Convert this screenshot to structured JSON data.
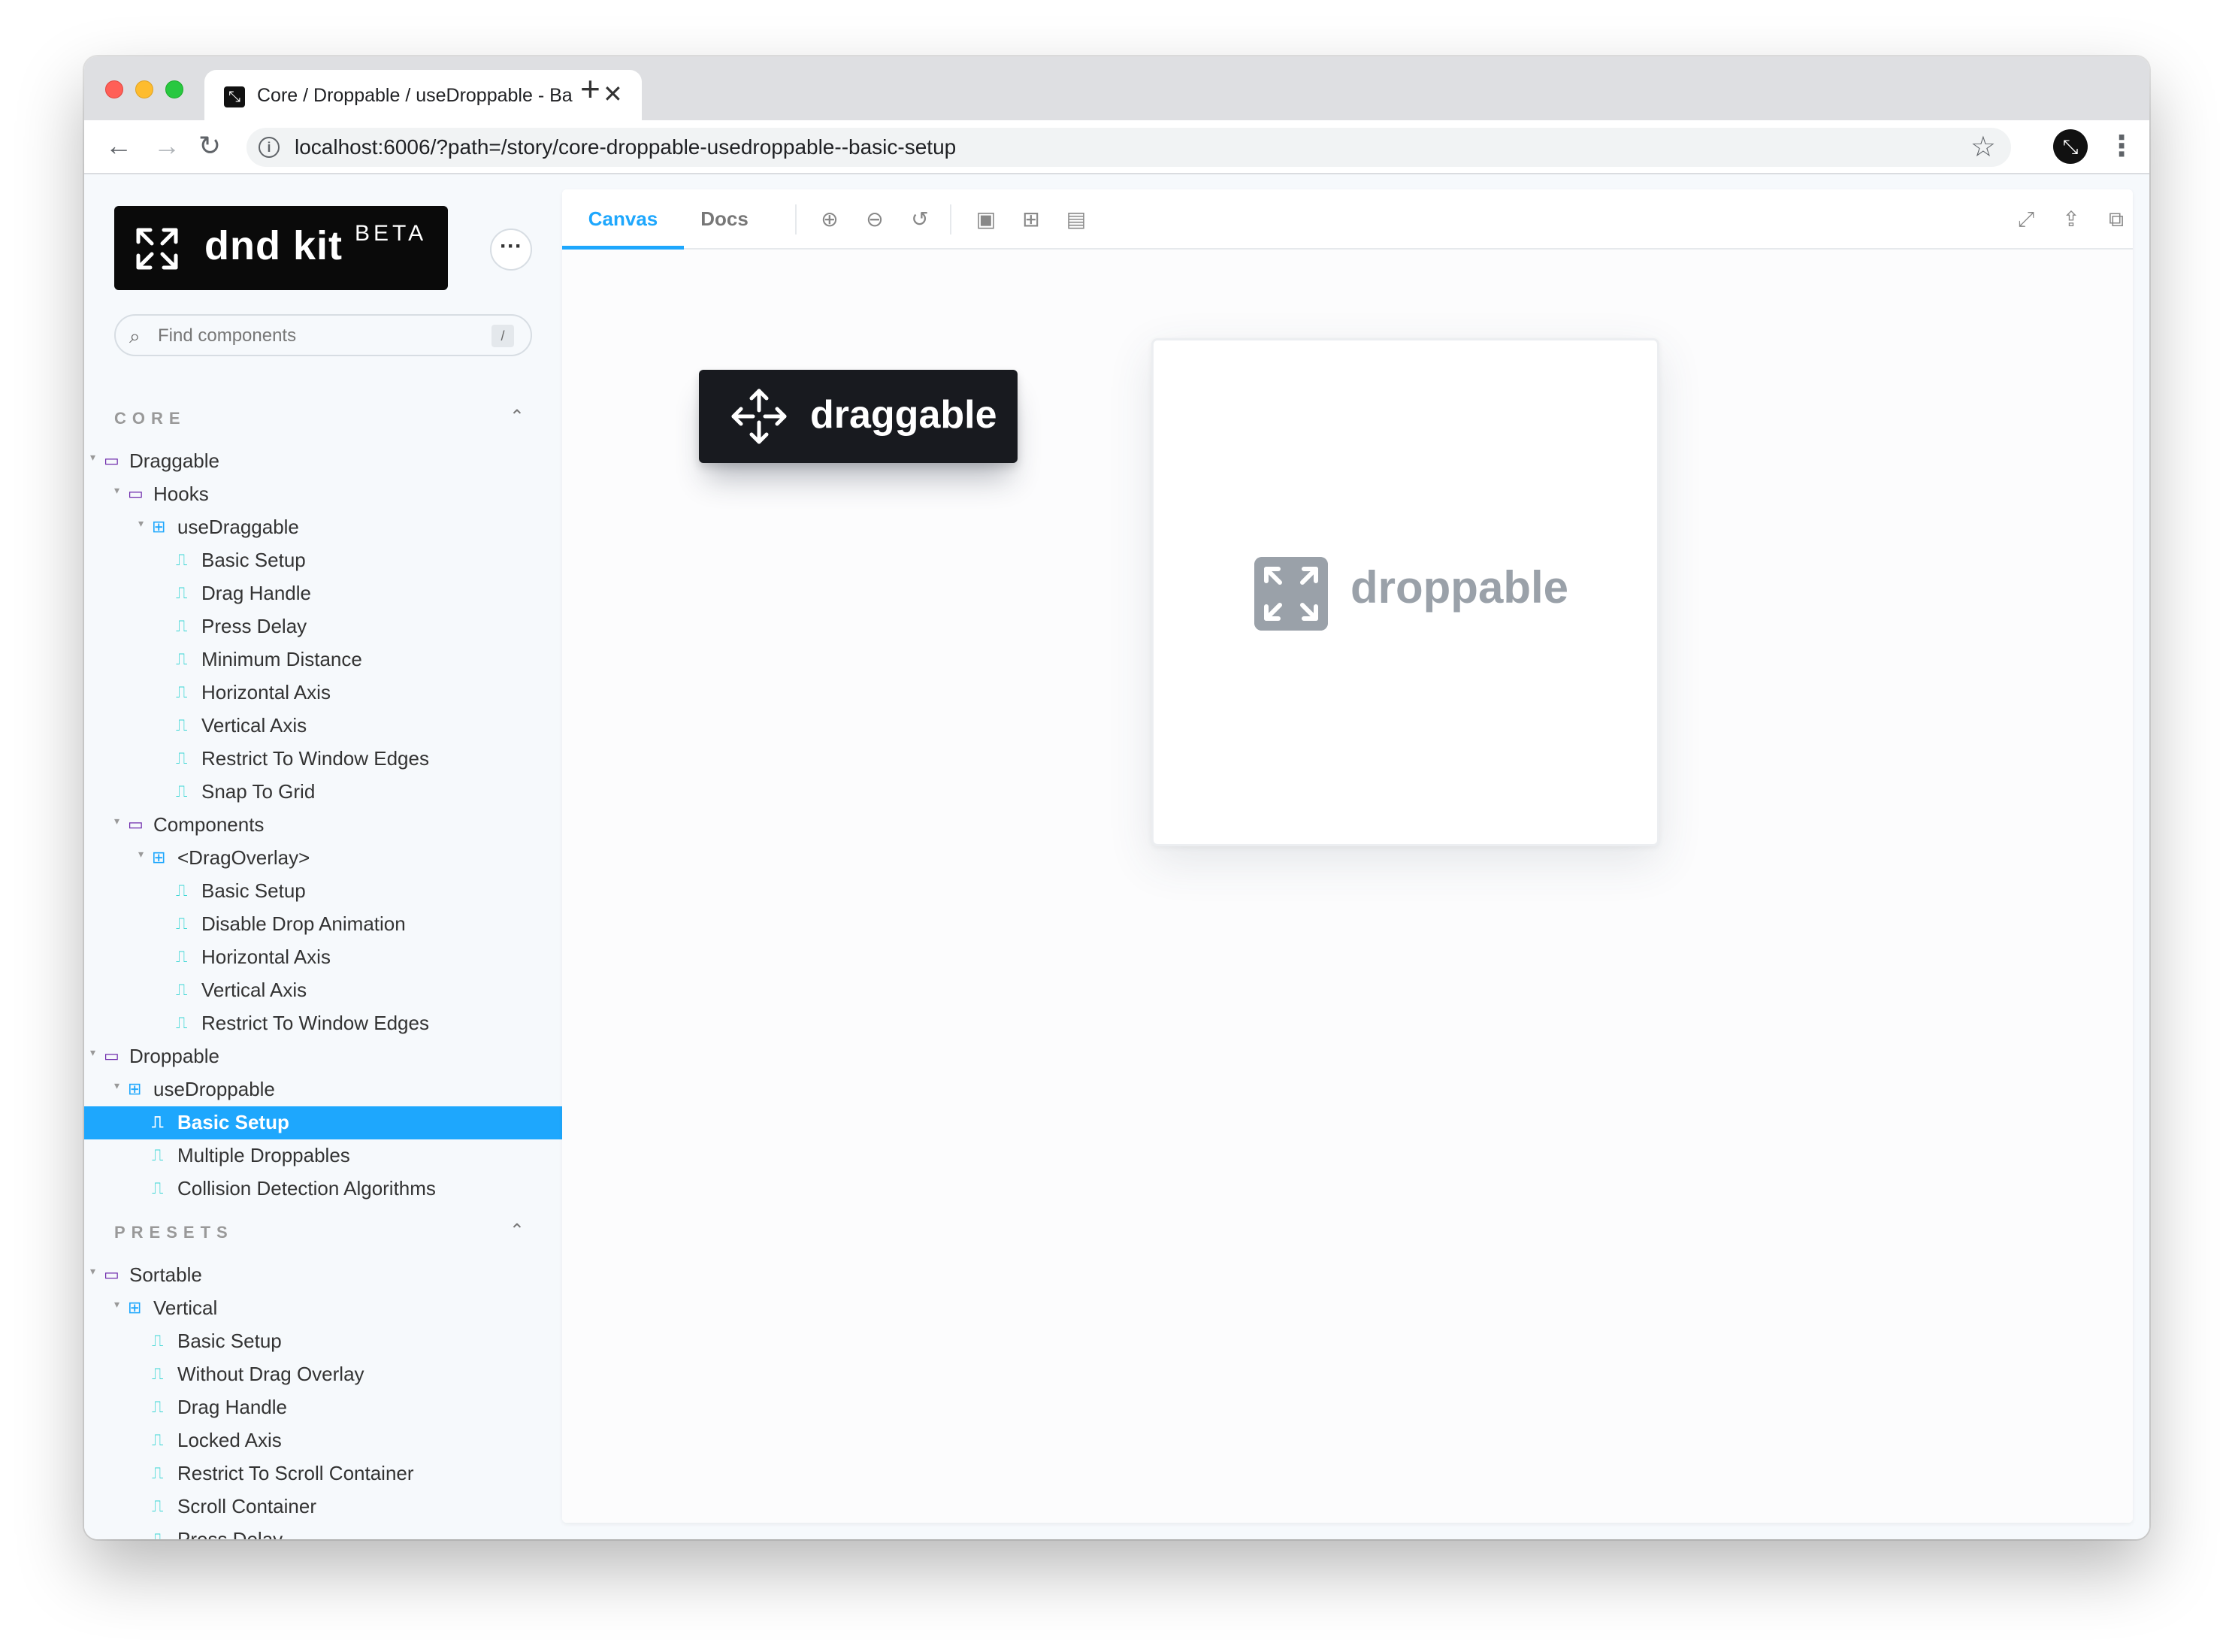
{
  "browser": {
    "tab_title": "Core / Droppable / useDroppable - Basic Setup",
    "tab_close": "✕",
    "new_tab": "+",
    "url": "localhost:6006/?path=/story/core-droppable-usedroppable--basic-setup"
  },
  "brand": {
    "name": "dnd kit",
    "badge": "BETA"
  },
  "search": {
    "placeholder": "Find components",
    "shortcut": "/"
  },
  "sections": [
    {
      "title": "CORE",
      "items": [
        {
          "label": "Draggable",
          "type": "folder",
          "depth": 0
        },
        {
          "label": "Hooks",
          "type": "folder",
          "depth": 1
        },
        {
          "label": "useDraggable",
          "type": "component",
          "depth": 2
        },
        {
          "label": "Basic Setup",
          "type": "story",
          "depth": 3
        },
        {
          "label": "Drag Handle",
          "type": "story",
          "depth": 3
        },
        {
          "label": "Press Delay",
          "type": "story",
          "depth": 3
        },
        {
          "label": "Minimum Distance",
          "type": "story",
          "depth": 3
        },
        {
          "label": "Horizontal Axis",
          "type": "story",
          "depth": 3
        },
        {
          "label": "Vertical Axis",
          "type": "story",
          "depth": 3
        },
        {
          "label": "Restrict To Window Edges",
          "type": "story",
          "depth": 3
        },
        {
          "label": "Snap To Grid",
          "type": "story",
          "depth": 3
        },
        {
          "label": "Components",
          "type": "folder",
          "depth": 1
        },
        {
          "label": "<DragOverlay>",
          "type": "component",
          "depth": 2
        },
        {
          "label": "Basic Setup",
          "type": "story",
          "depth": 3
        },
        {
          "label": "Disable Drop Animation",
          "type": "story",
          "depth": 3
        },
        {
          "label": "Horizontal Axis",
          "type": "story",
          "depth": 3
        },
        {
          "label": "Vertical Axis",
          "type": "story",
          "depth": 3
        },
        {
          "label": "Restrict To Window Edges",
          "type": "story",
          "depth": 3
        },
        {
          "label": "Droppable",
          "type": "folder",
          "depth": 0
        },
        {
          "label": "useDroppable",
          "type": "component",
          "depth": 1
        },
        {
          "label": "Basic Setup",
          "type": "story",
          "depth": 2,
          "selected": true
        },
        {
          "label": "Multiple Droppables",
          "type": "story",
          "depth": 2
        },
        {
          "label": "Collision Detection Algorithms",
          "type": "story",
          "depth": 2
        }
      ]
    },
    {
      "title": "PRESETS",
      "items": [
        {
          "label": "Sortable",
          "type": "folder",
          "depth": 0
        },
        {
          "label": "Vertical",
          "type": "component",
          "depth": 1
        },
        {
          "label": "Basic Setup",
          "type": "story",
          "depth": 2
        },
        {
          "label": "Without Drag Overlay",
          "type": "story",
          "depth": 2
        },
        {
          "label": "Drag Handle",
          "type": "story",
          "depth": 2
        },
        {
          "label": "Locked Axis",
          "type": "story",
          "depth": 2
        },
        {
          "label": "Restrict To Scroll Container",
          "type": "story",
          "depth": 2
        },
        {
          "label": "Scroll Container",
          "type": "story",
          "depth": 2
        },
        {
          "label": "Press Delay",
          "type": "story",
          "depth": 2
        }
      ]
    }
  ],
  "preview": {
    "tabs": [
      "Canvas",
      "Docs"
    ],
    "active_tab": "Canvas",
    "tools": [
      "zoom-in-icon",
      "zoom-out-icon",
      "zoom-reset-icon",
      "background-icon",
      "grid-icon",
      "viewport-icon"
    ],
    "right_tools": [
      "fullscreen-icon",
      "share-icon",
      "copy-link-icon"
    ]
  },
  "story": {
    "draggable_label": "draggable",
    "droppable_label": "droppable"
  },
  "colors": {
    "accent": "#1ea7fd",
    "story_icon": "#37d5d3",
    "folder_icon": "#6f2cac",
    "droppable_gray": "#9aa1a9",
    "draggable_bg": "#181a1f"
  }
}
